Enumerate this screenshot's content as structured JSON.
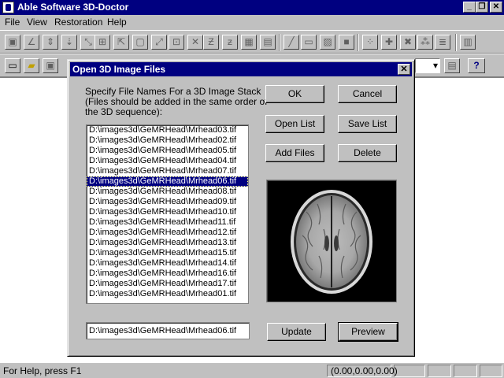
{
  "app": {
    "title": "Able Software 3D-Doctor",
    "minimize_glyph": "_",
    "restore_glyph": "❐",
    "close_glyph": "✕"
  },
  "menu": [
    "File",
    "View",
    "Restoration",
    "Help"
  ],
  "toolbar1_icons": [
    "select-region-icon",
    "line-tool-icon",
    "move-up-icon",
    "move-down-icon",
    "expand-icon",
    "grid-icon",
    "zoom-icon",
    "box-icon",
    "resize-icon",
    "crop-icon",
    "cross-icon",
    "z-up-icon",
    "z-down-icon",
    "filter-icon",
    "stack-icon",
    "pen-icon",
    "monitor-icon",
    "image-icon",
    "square-icon",
    "vertex-icon",
    "add-point-icon",
    "delete-point-icon",
    "network-icon",
    "align-icon",
    "resample-icon"
  ],
  "toolbar2": {
    "help_glyph": "?"
  },
  "dialog": {
    "title": "Open 3D Image Files",
    "close_glyph": "✕",
    "instructions": [
      "Specify File Names For a 3D Image Stack",
      "(Files should be added in the same order of",
      "the 3D sequence):"
    ],
    "files": [
      "D:\\images3d\\GeMRHead\\Mrhead03.tif",
      "D:\\images3d\\GeMRHead\\Mrhead02.tif",
      "D:\\images3d\\GeMRHead\\Mrhead05.tif",
      "D:\\images3d\\GeMRHead\\Mrhead04.tif",
      "D:\\images3d\\GeMRHead\\Mrhead07.tif",
      "D:\\images3d\\GeMRHead\\Mrhead06.tif",
      "D:\\images3d\\GeMRHead\\Mrhead08.tif",
      "D:\\images3d\\GeMRHead\\Mrhead09.tif",
      "D:\\images3d\\GeMRHead\\Mrhead10.tif",
      "D:\\images3d\\GeMRHead\\Mrhead11.tif",
      "D:\\images3d\\GeMRHead\\Mrhead12.tif",
      "D:\\images3d\\GeMRHead\\Mrhead13.tif",
      "D:\\images3d\\GeMRHead\\Mrhead15.tif",
      "D:\\images3d\\GeMRHead\\Mrhead14.tif",
      "D:\\images3d\\GeMRHead\\Mrhead16.tif",
      "D:\\images3d\\GeMRHead\\Mrhead17.tif",
      "D:\\images3d\\GeMRHead\\Mrhead01.tif"
    ],
    "selected_index": 5,
    "current_path": "D:\\images3d\\GeMRHead\\Mrhead06.tif",
    "buttons": {
      "ok": "OK",
      "cancel": "Cancel",
      "open_list": "Open List",
      "save_list": "Save List",
      "add_files": "Add Files",
      "delete": "Delete",
      "update": "Update",
      "preview": "Preview"
    }
  },
  "status": {
    "help_text": "For Help, press F1",
    "coords": "(0.00,0.00,0.00)"
  },
  "colors": {
    "title_bar": "#000080",
    "face": "#c0c0c0",
    "selection": "#000080"
  }
}
